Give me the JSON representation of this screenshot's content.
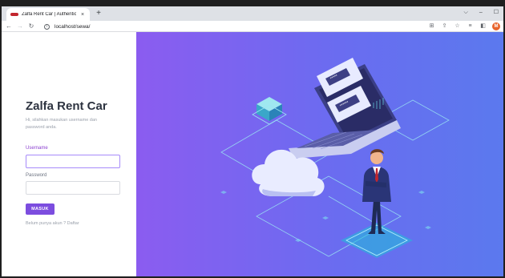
{
  "browser": {
    "tab_title": "Zalfa Rent Car | Authenticati",
    "tab_close": "×",
    "new_tab": "+",
    "url": "localhost/sewa/",
    "profile_initial": "M"
  },
  "login": {
    "brand": "Zalfa Rent Car",
    "subtitle": "Hi, silahkan masukan username dan password anda.",
    "username_label": "Username",
    "username_value": "",
    "password_label": "Password",
    "password_value": "",
    "submit_label": "MASUK",
    "register_text": "Belum punya akun ? Daftar"
  },
  "hero": {
    "screen_password_mask": "*****",
    "screen_password_mask_2": "******"
  },
  "colors": {
    "accent": "#7c4ddf",
    "hero_start": "#8b5cf0",
    "hero_end": "#5b79ee"
  }
}
